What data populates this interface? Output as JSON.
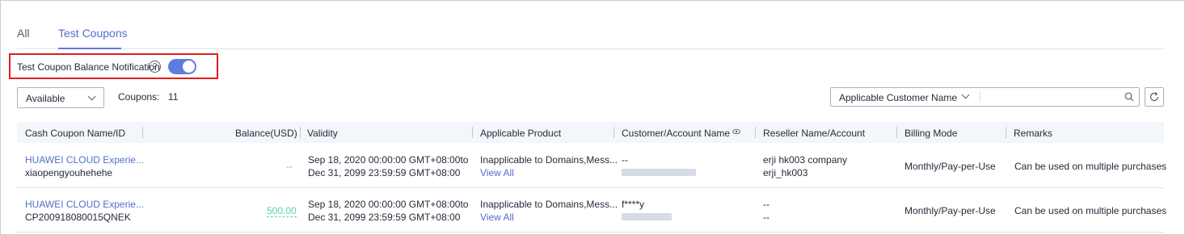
{
  "tabs": [
    {
      "label": "All",
      "active": false
    },
    {
      "label": "Test Coupons",
      "active": true
    }
  ],
  "notification": {
    "label": "Test Coupon Balance Notification",
    "help_glyph": "?",
    "toggle_on": true
  },
  "filter": {
    "status_value": "Available",
    "coupons_label": "Coupons:",
    "coupons_count": "11"
  },
  "search": {
    "field_label": "Applicable Customer Name",
    "value": "",
    "placeholder": ""
  },
  "table": {
    "headers": {
      "name": "Cash Coupon Name/ID",
      "balance": "Balance(USD)",
      "validity": "Validity",
      "product": "Applicable Product",
      "customer": "Customer/Account Name",
      "reseller": "Reseller Name/Account",
      "billing": "Billing Mode",
      "remarks": "Remarks"
    },
    "rows": [
      {
        "name": "HUAWEI CLOUD Experie...",
        "id": "xiaopengyouhehehe",
        "balance": "--",
        "validity_start": "Sep 18, 2020 00:00:00 GMT+08:00to",
        "validity_end": "Dec 31, 2099 23:59:59 GMT+08:00",
        "product": "Inapplicable to Domains,Mess...",
        "product_link": "View All",
        "customer_name": "--",
        "reseller_name": "erji hk003 company",
        "reseller_account": "erji_hk003",
        "billing": "Monthly/Pay-per-Use",
        "remarks": "Can be used on multiple purchases"
      },
      {
        "name": "HUAWEI CLOUD Experie...",
        "id": "CP200918080015QNEK",
        "balance": "500.00",
        "validity_start": "Sep 18, 2020 00:00:00 GMT+08:00to",
        "validity_end": "Dec 31, 2099 23:59:59 GMT+08:00",
        "product": "Inapplicable to Domains,Mess...",
        "product_link": "View All",
        "customer_name": "f****y",
        "reseller_name": "--",
        "reseller_account": "--",
        "billing": "Monthly/Pay-per-Use",
        "remarks": "Can be used on multiple purchases"
      }
    ]
  },
  "colors": {
    "accent": "#5e7ce0",
    "link": "#526ecc",
    "balance": "#50d4ab",
    "highlight_box": "#e01e1e"
  },
  "icons": [
    "help-icon",
    "chevron-down-icon",
    "search-icon",
    "refresh-icon",
    "eye-icon"
  ]
}
